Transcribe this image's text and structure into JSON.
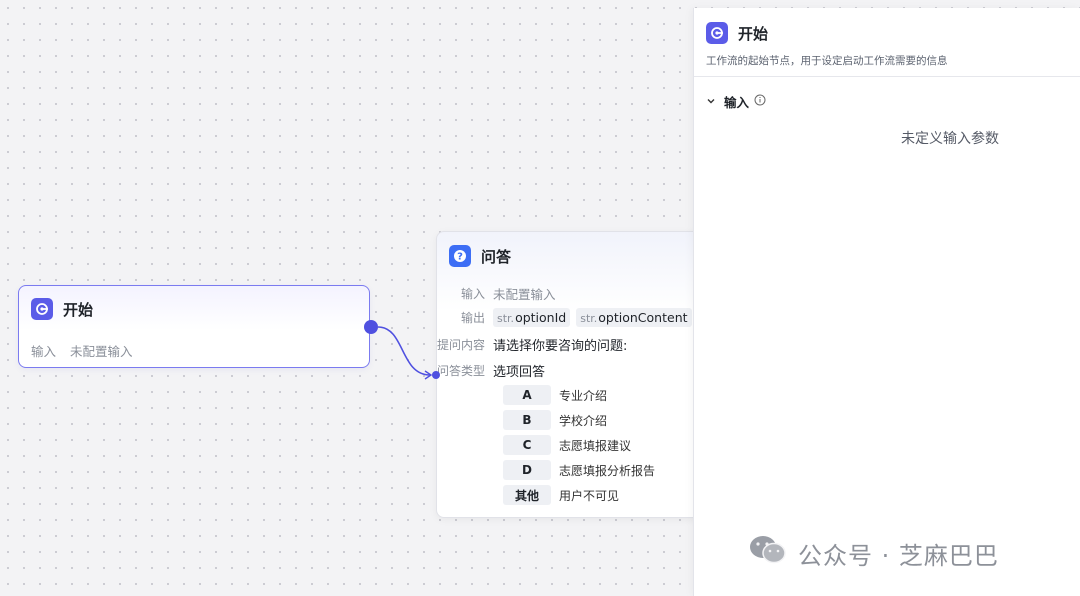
{
  "start_node": {
    "title": "开始",
    "input_label": "输入",
    "input_value": "未配置输入"
  },
  "qa_node": {
    "title": "问答",
    "input_label": "输入",
    "input_value": "未配置输入",
    "output_label": "输出",
    "outputs": [
      {
        "type": "str.",
        "name": "optionId"
      },
      {
        "type": "str.",
        "name": "optionContent"
      }
    ],
    "question_label": "提问内容",
    "question_value": "请选择你要咨询的问题:",
    "answer_type_label": "问答类型",
    "answer_type_value": "选项回答",
    "options": [
      {
        "key": "A",
        "text": "专业介绍"
      },
      {
        "key": "B",
        "text": "学校介绍"
      },
      {
        "key": "C",
        "text": "志愿填报建议"
      },
      {
        "key": "D",
        "text": "志愿填报分析报告"
      },
      {
        "key": "其他",
        "text": "用户不可见"
      }
    ]
  },
  "panel": {
    "title": "开始",
    "description": "工作流的起始节点，用于设定启动工作流需要的信息",
    "section_title": "输入",
    "empty_message": "未定义输入参数"
  },
  "watermark": {
    "text": "公众号 · 芝麻巴巴"
  },
  "colors": {
    "accent": "#5b5ce8",
    "qa_icon": "#3d6ef5",
    "edge": "#4f50e0"
  }
}
